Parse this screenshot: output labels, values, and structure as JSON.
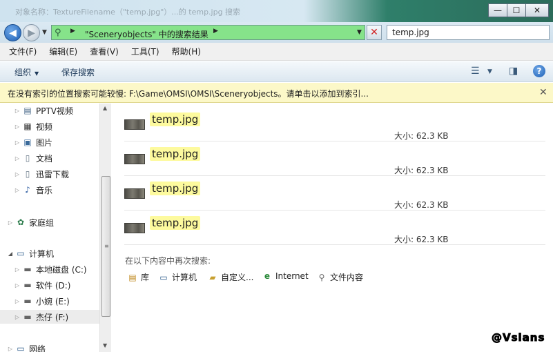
{
  "window": {
    "title": "对象名称：TextureFilename（\"temp.jpg\"）...的 temp.jpg 搜索",
    "controls": {
      "minimize": "—",
      "maximize": "☐",
      "close": "✕"
    }
  },
  "address": {
    "path": "\"Sceneryobjects\" 中的搜索结果",
    "search_value": "temp.jpg"
  },
  "menu": [
    "文件(F)",
    "编辑(E)",
    "查看(V)",
    "工具(T)",
    "帮助(H)"
  ],
  "toolbar": {
    "organize": "组织",
    "save_search": "保存搜索"
  },
  "infobar": {
    "text": "在没有索引的位置搜索可能较慢: F:\\Game\\OMSI\\OMSI\\Sceneryobjects。请单击以添加到索引..."
  },
  "nav": {
    "items": [
      {
        "label": "PPTV视频",
        "icon": "library-icon"
      },
      {
        "label": "视频",
        "icon": "video-icon"
      },
      {
        "label": "图片",
        "icon": "picture-icon"
      },
      {
        "label": "文档",
        "icon": "document-icon"
      },
      {
        "label": "迅雷下载",
        "icon": "download-icon"
      },
      {
        "label": "音乐",
        "icon": "music-icon"
      },
      {
        "label": "家庭组",
        "icon": "homegroup-icon"
      },
      {
        "label": "计算机",
        "icon": "computer-icon"
      },
      {
        "label": "本地磁盘 (C:)",
        "icon": "drive-icon"
      },
      {
        "label": "软件 (D:)",
        "icon": "drive-icon"
      },
      {
        "label": "小婉 (E:)",
        "icon": "drive-icon"
      },
      {
        "label": "杰仔 (F:)",
        "icon": "drive-icon"
      },
      {
        "label": "网络",
        "icon": "network-icon"
      }
    ]
  },
  "results": {
    "size_label": "大小:",
    "items": [
      {
        "name": "temp.jpg",
        "size": "62.3 KB"
      },
      {
        "name": "temp.jpg",
        "size": "62.3 KB"
      },
      {
        "name": "temp.jpg",
        "size": "62.3 KB"
      },
      {
        "name": "temp.jpg",
        "size": "62.3 KB"
      }
    ]
  },
  "search_again": {
    "heading": "在以下内容中再次搜索:",
    "options": [
      "库",
      "计算机",
      "自定义...",
      "Internet",
      "文件内容"
    ]
  },
  "watermark": "@Vsians",
  "colors": {
    "highlight": "#fdfa9e",
    "address_bar": "#86e38a",
    "infobar": "#fcf8c8"
  }
}
